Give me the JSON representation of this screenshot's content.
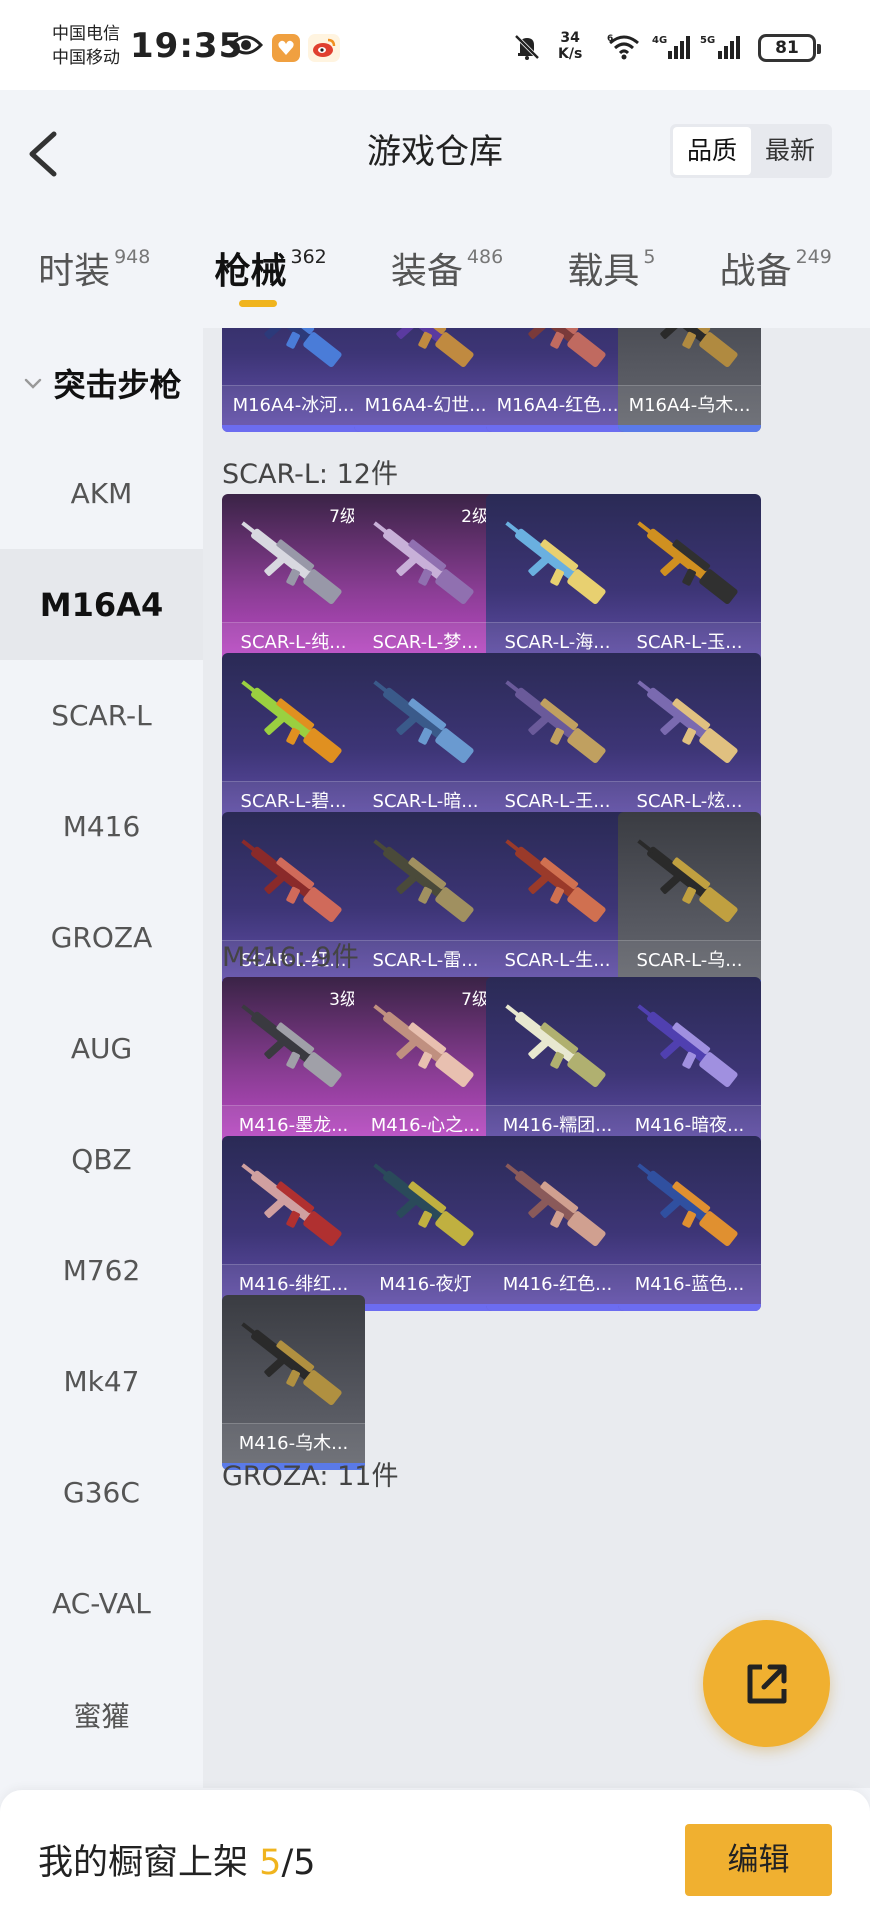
{
  "status_bar": {
    "carrier1": "中国电信",
    "carrier2": "中国移动",
    "time": "19:35",
    "net_speed_value": "34",
    "net_speed_unit": "K/s",
    "battery": "81"
  },
  "header": {
    "title": "游戏仓库",
    "sort_options": [
      "品质",
      "最新"
    ],
    "active_sort": "品质"
  },
  "tabs": [
    {
      "label": "时装",
      "count": "948"
    },
    {
      "label": "枪械",
      "count": "362"
    },
    {
      "label": "装备",
      "count": "486"
    },
    {
      "label": "载具",
      "count": "5"
    },
    {
      "label": "战备",
      "count": "249"
    }
  ],
  "active_tab": "枪械",
  "sidebar": {
    "category": "突击步枪",
    "items": [
      "AKM",
      "M16A4",
      "SCAR-L",
      "M416",
      "GROZA",
      "AUG",
      "QBZ",
      "M762",
      "Mk47",
      "G36C",
      "AC-VAL",
      "蜜獾"
    ],
    "active_item": "M16A4"
  },
  "sections": [
    {
      "title": "",
      "cards": [
        {
          "name": "M16A4-冰河...",
          "rarity": "legendary"
        },
        {
          "name": "M16A4-幻世...",
          "rarity": "legendary"
        },
        {
          "name": "M16A4-红色...",
          "rarity": "legendary"
        },
        {
          "name": "M16A4-乌木...",
          "rarity": "common"
        }
      ]
    },
    {
      "title": "SCAR-L: 12件",
      "cards": [
        {
          "name": "SCAR-L-纯...",
          "rarity": "mythic",
          "level": "7级"
        },
        {
          "name": "SCAR-L-梦...",
          "rarity": "mythic",
          "level": "2级"
        },
        {
          "name": "SCAR-L-海...",
          "rarity": "legendary"
        },
        {
          "name": "SCAR-L-玉...",
          "rarity": "legendary"
        },
        {
          "name": "SCAR-L-碧...",
          "rarity": "legendary"
        },
        {
          "name": "SCAR-L-暗...",
          "rarity": "legendary"
        },
        {
          "name": "SCAR-L-王...",
          "rarity": "legendary"
        },
        {
          "name": "SCAR-L-炫...",
          "rarity": "legendary"
        },
        {
          "name": "SCAR-L-红...",
          "rarity": "legendary"
        },
        {
          "name": "SCAR-L-雷...",
          "rarity": "legendary"
        },
        {
          "name": "SCAR-L-生...",
          "rarity": "legendary"
        },
        {
          "name": "SCAR-L-乌...",
          "rarity": "common"
        }
      ]
    },
    {
      "title": "M416: 9件",
      "cards": [
        {
          "name": "M416-墨龙...",
          "rarity": "mythic",
          "level": "3级"
        },
        {
          "name": "M416-心之...",
          "rarity": "mythic",
          "level": "7级"
        },
        {
          "name": "M416-糯团...",
          "rarity": "legendary"
        },
        {
          "name": "M416-暗夜...",
          "rarity": "legendary"
        },
        {
          "name": "M416-绯红...",
          "rarity": "legendary"
        },
        {
          "name": "M416-夜灯",
          "rarity": "legendary"
        },
        {
          "name": "M416-红色...",
          "rarity": "legendary"
        },
        {
          "name": "M416-蓝色...",
          "rarity": "legendary"
        },
        {
          "name": "M416-乌木...",
          "rarity": "common"
        }
      ]
    },
    {
      "title": "GROZA: 11件",
      "cards": []
    }
  ],
  "bottom_bar": {
    "shelf_label": "我的橱窗上架",
    "shelf_used": "5",
    "shelf_total": "/5",
    "edit_label": "编辑"
  },
  "colors": {
    "accent": "#f0b030",
    "legendary_bar": "#6c6cf0",
    "mythic_bar": "#d653e0"
  },
  "icons": [
    "eye-icon",
    "app-icon",
    "weibo-icon",
    "mute-bell-icon",
    "wifi-icon",
    "signal-icon",
    "back-icon",
    "chevron-down-icon",
    "share-out-icon",
    "rifle-icon"
  ]
}
